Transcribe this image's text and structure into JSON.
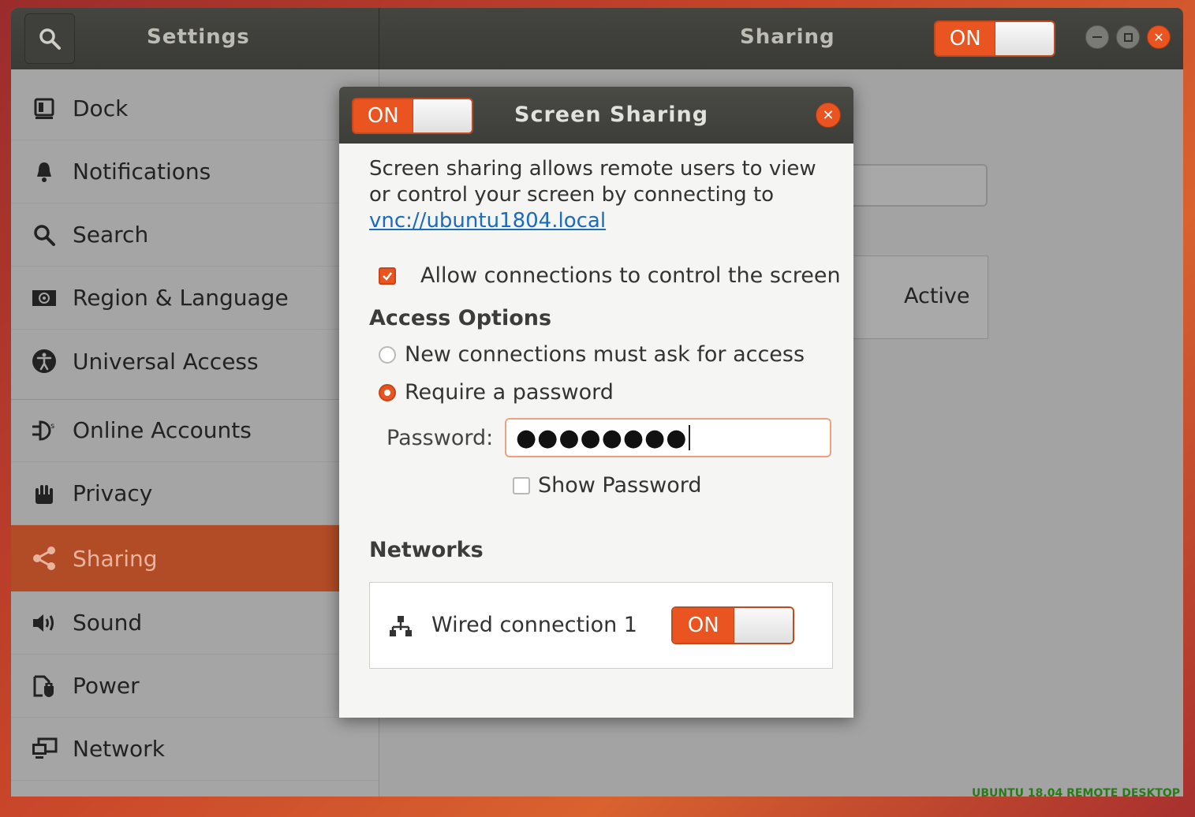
{
  "header": {
    "app_title": "Settings",
    "panel_title": "Sharing",
    "toggle_label": "ON"
  },
  "sidebar": {
    "items": [
      {
        "label": "Dock",
        "icon": "dock-icon"
      },
      {
        "label": "Notifications",
        "icon": "bell-icon"
      },
      {
        "label": "Search",
        "icon": "search-icon"
      },
      {
        "label": "Region & Language",
        "icon": "region-icon"
      },
      {
        "label": "Universal Access",
        "icon": "accessibility-icon"
      },
      {
        "label": "Online Accounts",
        "icon": "online-accounts-icon"
      },
      {
        "label": "Privacy",
        "icon": "hand-icon"
      },
      {
        "label": "Sharing",
        "icon": "share-icon",
        "active": true
      },
      {
        "label": "Sound",
        "icon": "speaker-icon"
      },
      {
        "label": "Power",
        "icon": "power-icon"
      },
      {
        "label": "Network",
        "icon": "network-icon"
      }
    ]
  },
  "background": {
    "active_status": "Active"
  },
  "dialog": {
    "title": "Screen Sharing",
    "toggle_label": "ON",
    "description_prefix": "Screen sharing allows remote users to view or control your screen by connecting to ",
    "link": "vnc://ubuntu1804.local",
    "allow_control_label": "Allow connections to control the screen",
    "allow_control_checked": true,
    "access_options_heading": "Access Options",
    "option_ask": "New connections must ask for access",
    "option_password": "Require a password",
    "selected_option": "password",
    "password_label": "Password:",
    "password_value": "●●●●●●●●",
    "show_password_label": "Show Password",
    "show_password_checked": false,
    "networks_heading": "Networks",
    "network_name": "Wired connection 1",
    "network_toggle_label": "ON"
  },
  "watermark": "UBUNTU 18.04 REMOTE DESKTOP",
  "colors": {
    "accent": "#e95420",
    "sidebar_active": "#b24c26",
    "link": "#1b6bbf"
  }
}
